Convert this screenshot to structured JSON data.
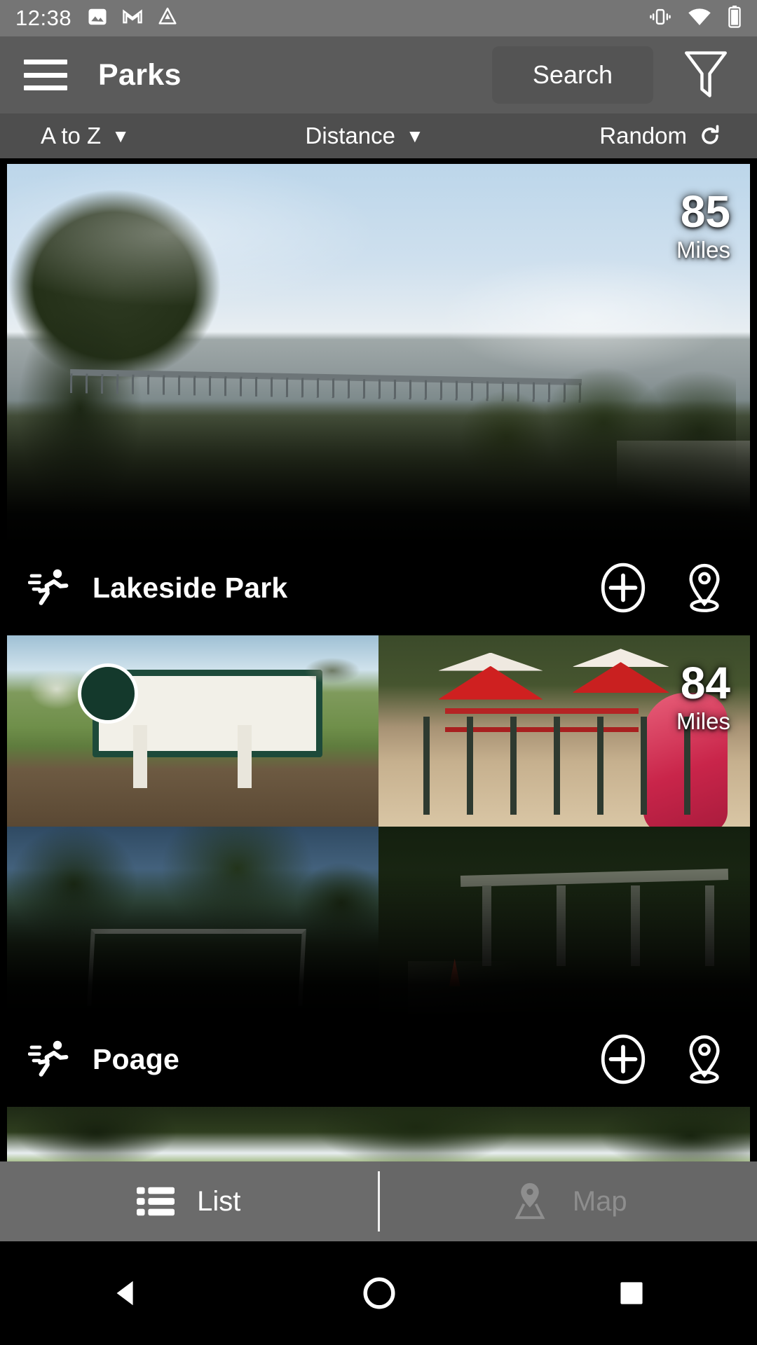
{
  "status_bar": {
    "time": "12:38",
    "left_icons": [
      "photos-icon",
      "gmail-icon",
      "drive-icon"
    ],
    "right_icons": [
      "vibrate-icon",
      "wifi-icon",
      "battery-icon"
    ],
    "background_color": "#757575"
  },
  "app_bar": {
    "menu_icon": "hamburger-menu-icon",
    "title": "Parks",
    "search_label": "Search",
    "filter_icon": "filter-funnel-icon",
    "background_color": "#5b5b5b"
  },
  "sort_bar": {
    "background_color": "#4e4e4e",
    "options": [
      {
        "label": "A to Z",
        "indicator": "caret-down-icon",
        "glyph": "▼"
      },
      {
        "label": "Distance",
        "indicator": "caret-down-icon",
        "glyph": "▼"
      },
      {
        "label": "Random",
        "indicator": "refresh-icon",
        "glyph": "↻"
      }
    ]
  },
  "cards": [
    {
      "title": "Lakeside Park",
      "distance_value": "85",
      "distance_unit": "Miles",
      "category_icon": "trail-running-icon",
      "add_label": "+",
      "add_icon": "plus-circle-icon",
      "map_icon": "map-pin-icon",
      "photo_count": 1
    },
    {
      "title": "Poage",
      "distance_value": "84",
      "distance_unit": "Miles",
      "category_icon": "trail-running-icon",
      "add_label": "+",
      "add_icon": "plus-circle-icon",
      "map_icon": "map-pin-icon",
      "photo_count": 4
    }
  ],
  "bottom_tabs": {
    "background_color": "#6b6b6b",
    "active_tab": "List",
    "tabs": [
      {
        "label": "List",
        "icon": "list-view-icon",
        "active": true
      },
      {
        "label": "Map",
        "icon": "map-pin-icon",
        "active": false
      }
    ]
  },
  "nav_bar": {
    "background_color": "#000000",
    "buttons": [
      {
        "name": "back",
        "icon": "back-triangle-icon"
      },
      {
        "name": "home",
        "icon": "home-circle-icon"
      },
      {
        "name": "recents",
        "icon": "recents-square-icon"
      }
    ]
  }
}
